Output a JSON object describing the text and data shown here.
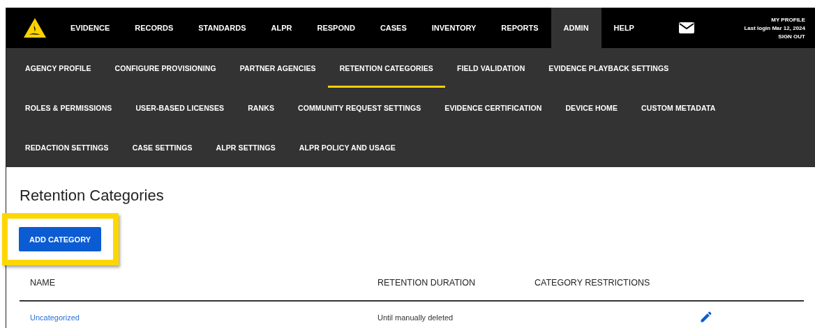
{
  "top_nav": {
    "items": [
      {
        "label": "EVIDENCE",
        "selected": false
      },
      {
        "label": "RECORDS",
        "selected": false
      },
      {
        "label": "STANDARDS",
        "selected": false
      },
      {
        "label": "ALPR",
        "selected": false
      },
      {
        "label": "RESPOND",
        "selected": false
      },
      {
        "label": "CASES",
        "selected": false
      },
      {
        "label": "INVENTORY",
        "selected": false
      },
      {
        "label": "REPORTS",
        "selected": false
      },
      {
        "label": "ADMIN",
        "selected": true
      },
      {
        "label": "HELP",
        "selected": false
      }
    ],
    "profile": {
      "link": "MY PROFILE",
      "last_login": "Last login Mar 12, 2024",
      "sign_out": "SIGN OUT"
    }
  },
  "sub_nav": {
    "rows": [
      [
        {
          "label": "AGENCY PROFILE",
          "selected": false
        },
        {
          "label": "CONFIGURE PROVISIONING",
          "selected": false
        },
        {
          "label": "PARTNER AGENCIES",
          "selected": false
        },
        {
          "label": "RETENTION CATEGORIES",
          "selected": true
        },
        {
          "label": "FIELD VALIDATION",
          "selected": false
        },
        {
          "label": "EVIDENCE PLAYBACK SETTINGS",
          "selected": false
        }
      ],
      [
        {
          "label": "ROLES & PERMISSIONS",
          "selected": false
        },
        {
          "label": "USER-BASED LICENSES",
          "selected": false
        },
        {
          "label": "RANKS",
          "selected": false
        },
        {
          "label": "COMMUNITY REQUEST SETTINGS",
          "selected": false
        },
        {
          "label": "EVIDENCE CERTIFICATION",
          "selected": false
        },
        {
          "label": "DEVICE HOME",
          "selected": false
        },
        {
          "label": "CUSTOM METADATA",
          "selected": false
        }
      ],
      [
        {
          "label": "REDACTION SETTINGS",
          "selected": false
        },
        {
          "label": "CASE SETTINGS",
          "selected": false
        },
        {
          "label": "ALPR SETTINGS",
          "selected": false
        },
        {
          "label": "ALPR POLICY AND USAGE",
          "selected": false
        }
      ]
    ]
  },
  "page": {
    "title": "Retention Categories",
    "add_button": "ADD CATEGORY"
  },
  "table": {
    "columns": [
      "NAME",
      "RETENTION DURATION",
      "CATEGORY RESTRICTIONS"
    ],
    "rows": [
      {
        "name": "Uncategorized",
        "duration": "Until manually deleted"
      }
    ]
  }
}
